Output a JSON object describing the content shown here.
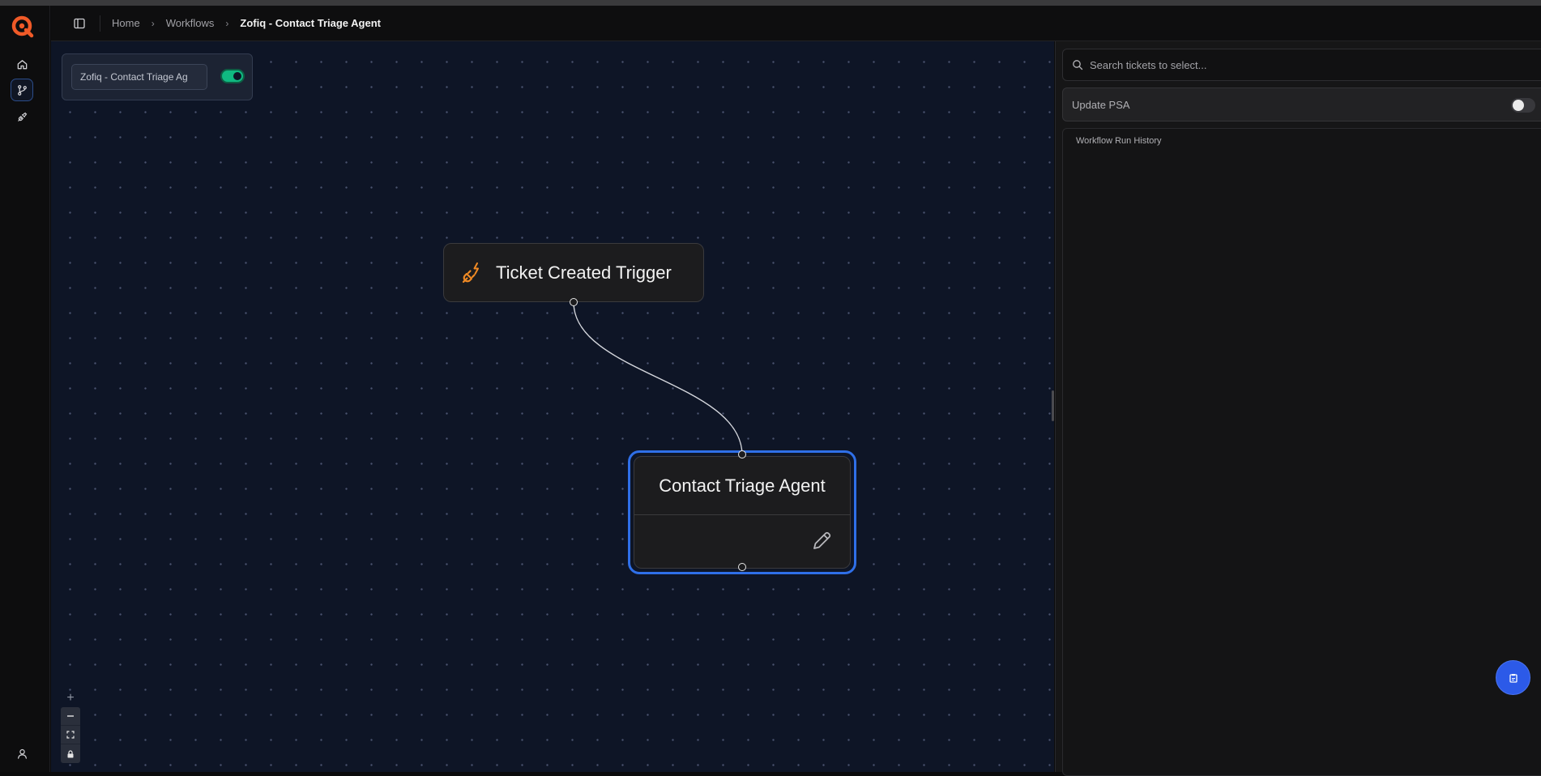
{
  "breadcrumb": {
    "items": [
      {
        "label": "Home"
      },
      {
        "label": "Workflows"
      },
      {
        "label": "Zofiq - Contact Triage Agent"
      }
    ]
  },
  "workflow": {
    "name_value": "Zofiq - Contact Triage Ag",
    "active": true
  },
  "nodes": {
    "trigger": {
      "label": "Ticket Created Trigger",
      "icon": "plug-bolt-icon"
    },
    "agent": {
      "label": "Contact Triage Agent",
      "icon": "pencil-icon",
      "selected": true
    }
  },
  "canvas_controls": {
    "plus": "+",
    "items": [
      "zoom-out-icon",
      "fit-view-icon",
      "lock-icon"
    ]
  },
  "side_panel": {
    "search_placeholder": "Search tickets to select...",
    "update_psa_label": "Update PSA",
    "update_psa_on": false,
    "history_title": "Workflow Run History"
  },
  "colors": {
    "accent": "#2f6fe8",
    "brand": "#f05a28",
    "toggle_on": "#10b981",
    "canvas_bg": "#0e1526"
  }
}
